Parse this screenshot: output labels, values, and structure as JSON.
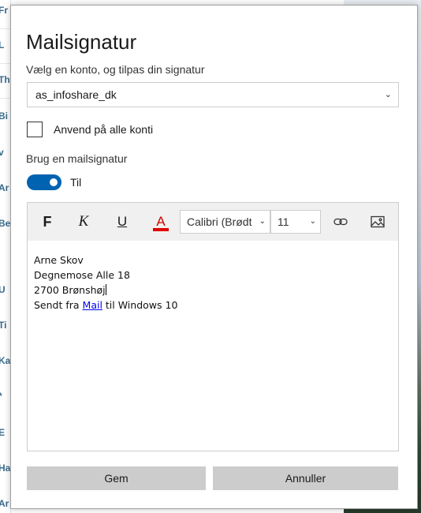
{
  "background": {
    "fragments": [
      "Fr",
      "L",
      "Th",
      "Bi",
      "v",
      "Ar",
      "Be",
      "U",
      "Ti",
      "Ka",
      "*",
      "E",
      "Ha",
      "Ar"
    ]
  },
  "dialog": {
    "title": "Mailsignatur",
    "account_label": "Vælg en konto, og tilpas din signatur",
    "account_value": "as_infoshare_dk",
    "apply_all_label": "Anvend på alle konti",
    "apply_all_checked": false,
    "use_signature_label": "Brug en mailsignatur",
    "toggle_state": "Til",
    "toggle_on": true,
    "toolbar": {
      "bold": "F",
      "italic": "K",
      "underline": "U",
      "font_color": "A",
      "font_color_hex": "#e00000",
      "font_family": "Calibri (Brødt",
      "font_size": "11",
      "link_icon": "link-icon",
      "image_icon": "image-icon"
    },
    "signature": {
      "line1": "Arne Skov",
      "line2": "Degnemose Alle 18",
      "line3": "2700 Brønshøj",
      "line4_prefix": "Sendt fra ",
      "line4_link": "Mail",
      "line4_suffix": " til Windows 10"
    },
    "save_label": "Gem",
    "cancel_label": "Annuller",
    "accent": "#0063b1"
  }
}
